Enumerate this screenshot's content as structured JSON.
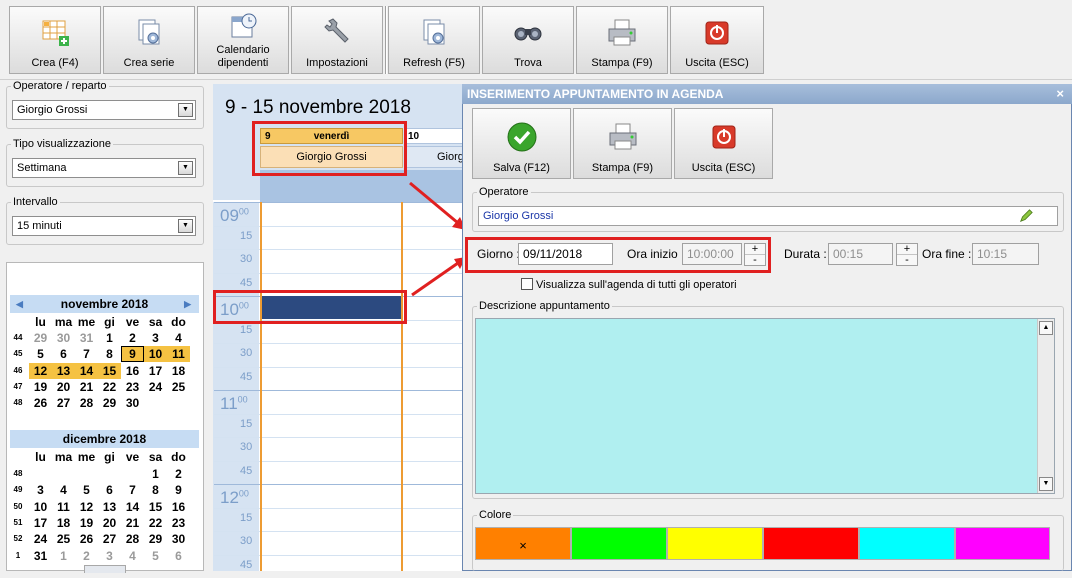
{
  "toolbar": {
    "buttons": [
      {
        "label": "Crea (F4)",
        "icon": "grid-add-icon"
      },
      {
        "label": "Crea serie",
        "icon": "pages-gear-icon"
      },
      {
        "label_line1": "Calendario",
        "label_line2": "dipendenti",
        "icon": "calendar-clock-icon"
      },
      {
        "label": "Impostazioni",
        "icon": "wrench-icon"
      },
      {
        "label": "Refresh (F5)",
        "icon": "pages-refresh-icon"
      },
      {
        "label": "Trova",
        "icon": "binoculars-icon"
      },
      {
        "label": "Stampa (F9)",
        "icon": "printer-icon"
      },
      {
        "label": "Uscita (ESC)",
        "icon": "power-icon"
      }
    ]
  },
  "sidebar": {
    "operator_label": "Operatore / reparto",
    "operator_value": "Giorgio Grossi",
    "view_label": "Tipo visualizzazione",
    "view_value": "Settimana",
    "interval_label": "Intervallo",
    "interval_value": "15 minuti"
  },
  "calendar_nov": {
    "title": "novembre 2018",
    "prev": "◀",
    "next": "▶",
    "weekdays": [
      "lu",
      "ma",
      "me",
      "gi",
      "ve",
      "sa",
      "do"
    ],
    "weeks": [
      "44",
      "45",
      "46",
      "47",
      "48"
    ],
    "rows": [
      [
        "29",
        "30",
        "31",
        "1",
        "2",
        "3",
        "4"
      ],
      [
        "5",
        "6",
        "7",
        "8",
        "9",
        "10",
        "11"
      ],
      [
        "12",
        "13",
        "14",
        "15",
        "16",
        "17",
        "18"
      ],
      [
        "19",
        "20",
        "21",
        "22",
        "23",
        "24",
        "25"
      ],
      [
        "26",
        "27",
        "28",
        "29",
        "30",
        "",
        ""
      ]
    ]
  },
  "calendar_dec": {
    "title": "dicembre 2018",
    "weekdays": [
      "lu",
      "ma",
      "me",
      "gi",
      "ve",
      "sa",
      "do"
    ],
    "weeks": [
      "48",
      "49",
      "50",
      "51",
      "52",
      "1"
    ],
    "rows": [
      [
        "",
        "",
        "",
        "",
        "",
        "1",
        "2"
      ],
      [
        "3",
        "4",
        "5",
        "6",
        "7",
        "8",
        "9"
      ],
      [
        "10",
        "11",
        "12",
        "13",
        "14",
        "15",
        "16"
      ],
      [
        "17",
        "18",
        "19",
        "20",
        "21",
        "22",
        "23"
      ],
      [
        "24",
        "25",
        "26",
        "27",
        "28",
        "29",
        "30"
      ],
      [
        "31",
        "1",
        "2",
        "3",
        "4",
        "5",
        "6"
      ]
    ]
  },
  "schedule": {
    "range_title": "9 - 15 novembre 2018",
    "day_num": "9",
    "day_name": "venerdì",
    "operator": "Giorgio Grossi",
    "next_day_num": "10",
    "next_operator": "Giorg",
    "hours": [
      "09",
      "10",
      "11",
      "12"
    ],
    "minutes_sup": "00",
    "quarters": [
      "15",
      "30",
      "45"
    ]
  },
  "dialog": {
    "title": "INSERIMENTO APPUNTAMENTO IN AGENDA",
    "close": "×",
    "buttons": [
      {
        "label": "Salva (F12)",
        "icon": "check-icon"
      },
      {
        "label": "Stampa (F9)",
        "icon": "printer-icon"
      },
      {
        "label": "Uscita (ESC)",
        "icon": "power-icon"
      }
    ],
    "operator_group": "Operatore",
    "operator_value": "Giorgio Grossi",
    "giorno_label": "Giorno :",
    "giorno_value": "09/11/2018",
    "ora_inizio_label": "Ora inizio :",
    "ora_inizio_value": "10:00:00",
    "durata_label": "Durata :",
    "durata_value": "00:15",
    "ora_fine_label": "Ora fine :",
    "ora_fine_value": "10:15",
    "plus": "+",
    "minus": "-",
    "checkbox_label": "Visualizza sull'agenda di tutti gli operatori",
    "descr_group": "Descrizione appuntamento",
    "scroll_up": "▲",
    "scroll_down": "▼",
    "color_group": "Colore",
    "selected_mark": "×",
    "colors": [
      "#ff8000",
      "#00ff00",
      "#ffff00",
      "#ff0000",
      "#00ffff",
      "#ff00ff"
    ]
  }
}
